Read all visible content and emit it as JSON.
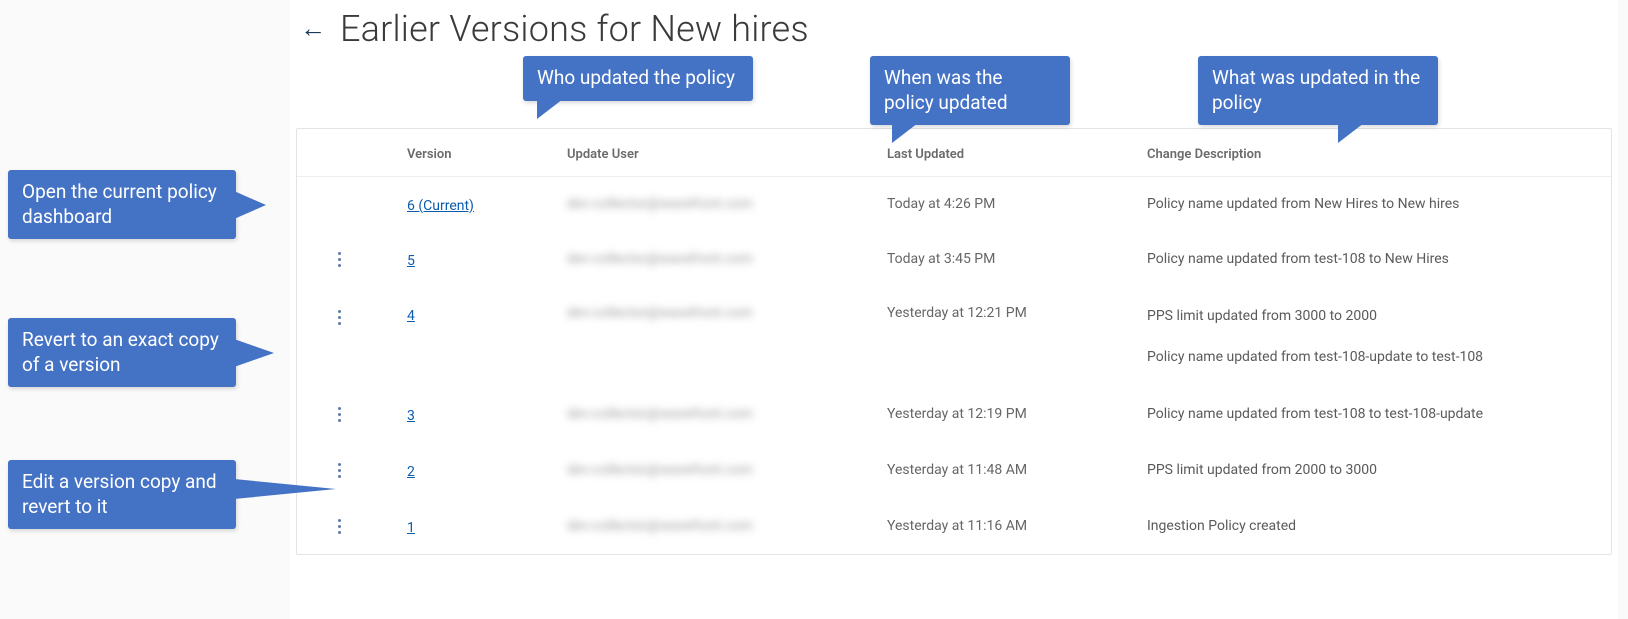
{
  "header": {
    "back_glyph": "←",
    "title": "Earlier Versions for New hires"
  },
  "columns": {
    "menu": "",
    "version": "Version",
    "update_user": "Update User",
    "last_updated": "Last Updated",
    "change_description": "Change Description"
  },
  "rows": [
    {
      "has_menu": false,
      "version_label": "6 (Current)",
      "update_user": "dev-collector@wavefront.com",
      "last_updated": "Today at 4:26 PM",
      "desc_lines": [
        "Policy name updated from New Hires to New hires"
      ]
    },
    {
      "has_menu": true,
      "version_label": "5",
      "update_user": "dev-collector@wavefront.com",
      "last_updated": "Today at 3:45 PM",
      "desc_lines": [
        "Policy name updated from test-108 to New Hires"
      ]
    },
    {
      "has_menu": true,
      "version_label": "4",
      "update_user": "dev-collector@wavefront.com",
      "last_updated": "Yesterday at 12:21 PM",
      "desc_lines": [
        "PPS limit updated from 3000 to 2000",
        "Policy name updated from test-108-update to test-108"
      ]
    },
    {
      "has_menu": true,
      "version_label": "3",
      "update_user": "dev-collector@wavefront.com",
      "last_updated": "Yesterday at 12:19 PM",
      "desc_lines": [
        "Policy name updated from test-108 to test-108-update"
      ]
    },
    {
      "has_menu": true,
      "version_label": "2",
      "update_user": "dev-collector@wavefront.com",
      "last_updated": "Yesterday at 11:48 AM",
      "desc_lines": [
        "PPS limit updated from 2000 to 3000"
      ]
    },
    {
      "has_menu": true,
      "version_label": "1",
      "update_user": "dev-collector@wavefront.com",
      "last_updated": "Yesterday at 11:16 AM",
      "desc_lines": [
        "Ingestion Policy created"
      ]
    }
  ],
  "callouts": {
    "who": "Who updated the policy",
    "when": "When was the policy updated",
    "what": "What was updated in the policy",
    "open": "Open the current policy dashboard",
    "revert": "Revert to an exact copy of a version",
    "edit": "Edit a version copy and revert to it"
  }
}
